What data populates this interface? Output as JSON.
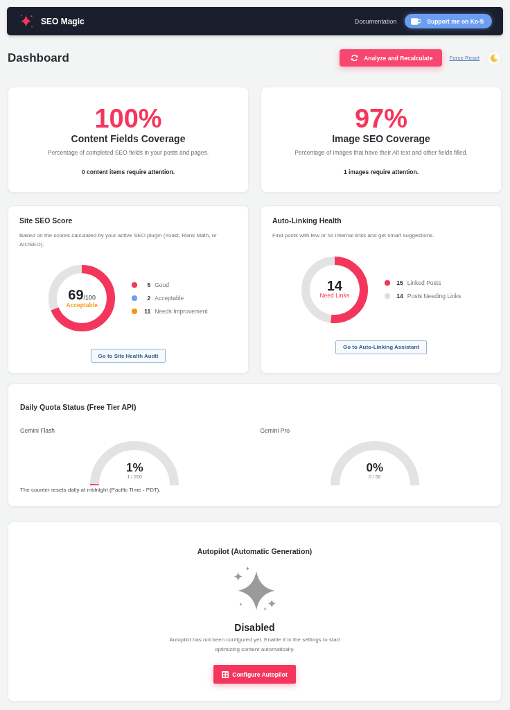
{
  "header": {
    "brand": "SEO Magic",
    "docs_link": "Documentation",
    "support_button": "Support me on Ko-fi"
  },
  "toolbar": {
    "title": "Dashboard",
    "analyze_button": "Analyze and Recalculate",
    "reset_link": "Force Reset"
  },
  "coverage_cards": [
    {
      "value": "100%",
      "title": "Content Fields Coverage",
      "description": "Percentage of completed SEO fields in your posts and pages.",
      "note": "0 content items require attention."
    },
    {
      "value": "97%",
      "title": "Image SEO Coverage",
      "description": "Percentage of images that have their Alt text and other fields filled.",
      "note": "1 images require attention."
    }
  ],
  "site_score": {
    "title": "Site SEO Score",
    "description": "Based on the scores calculated by your active SEO plugin (Yoast, Rank Math, or AIOSEO).",
    "score": "69",
    "max": "/100",
    "rating": "Acceptable",
    "level": 0.69,
    "legend": [
      {
        "count": "5",
        "label": "Good",
        "color": "#f5365c"
      },
      {
        "count": "2",
        "label": "Acceptable",
        "color": "#6d9eeb"
      },
      {
        "count": "11",
        "label": "Needs Improvement",
        "color": "#f7931a"
      }
    ],
    "button": "Go to Site Health Audit"
  },
  "auto_linking": {
    "title": "Auto-Linking Health",
    "description": "Find posts with few or no internal links and get smart suggestions.",
    "count": "14",
    "caption": "Need Links",
    "level": 0.52,
    "legend": [
      {
        "count": "15",
        "label": "Linked Posts",
        "color": "#f5365c"
      },
      {
        "count": "14",
        "label": "Posts Needing Links",
        "color": "#dddddd"
      }
    ],
    "button": "Go to Auto-Linking Assistant"
  },
  "quota": {
    "title": "Daily Quota Status (Free Tier API)",
    "gauges": [
      {
        "name": "Gemini Flash",
        "percent": "1%",
        "usage": "1 / 200",
        "level": 0.01
      },
      {
        "name": "Gemini Pro",
        "percent": "0%",
        "usage": "0 / 50"
      }
    ],
    "note": "The counter resets daily at midnight (Pacific Time - PDT)."
  },
  "autopilot": {
    "title": "Autopilot (Automatic Generation)",
    "status": "Disabled",
    "description": "Autopilot has not been configured yet. Enable it in the settings to start optimizing content automatically.",
    "button": "Configure Autopilot"
  }
}
